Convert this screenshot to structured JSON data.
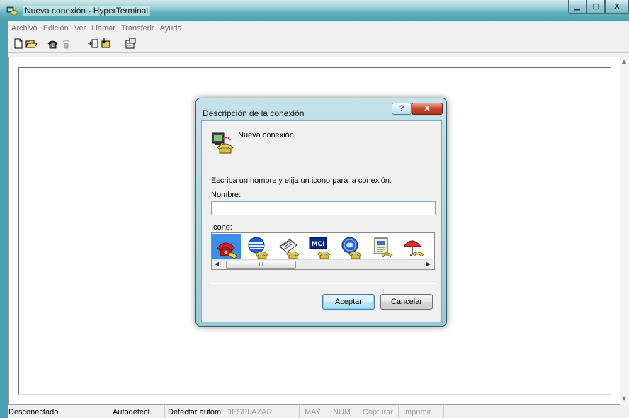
{
  "window": {
    "title": "Nueva conexión - HyperTerminal",
    "controls": {
      "minimize": "▁",
      "maximize": "□",
      "close": "X"
    }
  },
  "menu": [
    "Archivo",
    "Edición",
    "Ver",
    "Llamar",
    "Transferir",
    "Ayuda"
  ],
  "toolbar": [
    "new-file-icon",
    "open-folder-icon",
    "call-phone-icon",
    "disconnect-icon",
    "send-icon",
    "receive-icon",
    "properties-icon"
  ],
  "dialog": {
    "title": "Descripción de la conexión",
    "help": "?",
    "close": "X",
    "connection_name": "Nueva conexión",
    "prompt": "Escriba un nombre y elija un icono para la conexión:",
    "name_label": "Nombre:",
    "name_value": "",
    "icon_label": "Icono:",
    "icons": [
      "red-phone-icon",
      "globe-phone-icon",
      "fax-phone-icon",
      "mci-phone-icon",
      "ge-phone-icon",
      "notepad-phone-icon",
      "umbrella-phone-icon"
    ],
    "selected_icon": 0,
    "scroll_thumb_label": "III",
    "ok_label": "Aceptar",
    "cancel_label": "Cancelar"
  },
  "status": {
    "connection": "Desconectado",
    "autodetect": "Autodetect.",
    "detect": "Detectar autom",
    "scroll": "DESPLAZAR",
    "caps": "MAY",
    "num": "NUM",
    "capture": "Capturar",
    "print": "Imprimir"
  },
  "colors": {
    "title_gradient_start": "#d2e8ea",
    "title_gradient_end": "#4aa0b0",
    "selected_icon_bg": "#3a8ee6",
    "close_button": "#c8452f",
    "default_button_border": "#3c7fb1"
  }
}
